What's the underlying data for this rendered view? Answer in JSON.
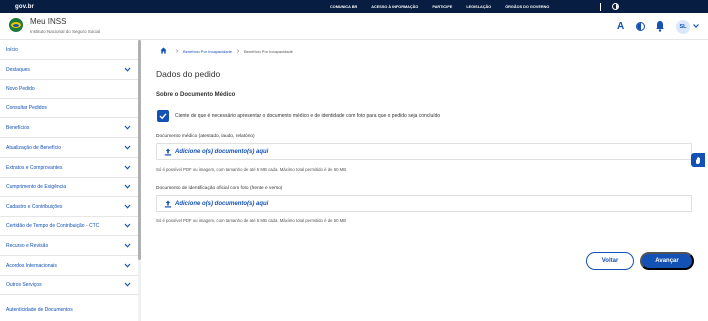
{
  "govbar": {
    "logo": "gov.br",
    "links": [
      "COMUNICA BR",
      "ACESSO À INFORMAÇÃO",
      "PARTICIPE",
      "LEGISLAÇÃO",
      "ÓRGÃOS DO GOVERNO"
    ]
  },
  "header": {
    "title": "Meu INSS",
    "subtitle": "Instituto Nacional do Seguro Social",
    "font_button": "A",
    "avatar_initials": "SL",
    "brand_color": "#1351b4"
  },
  "sidebar": {
    "items": [
      {
        "label": "Início",
        "has_chevron": false
      },
      {
        "label": "Destaques",
        "has_chevron": true
      },
      {
        "label": "Novo Pedido",
        "has_chevron": false
      },
      {
        "label": "Consultar Pedidos",
        "has_chevron": false
      },
      {
        "label": "Benefícios",
        "has_chevron": true
      },
      {
        "label": "Atualização de Benefício",
        "has_chevron": true
      },
      {
        "label": "Extratos e Comprovantes",
        "has_chevron": true
      },
      {
        "label": "Cumprimento de Exigência",
        "has_chevron": true
      },
      {
        "label": "Cadastro e Contribuições",
        "has_chevron": true
      },
      {
        "label": "Certidão de Tempo de Contribuição - CTC",
        "has_chevron": true
      },
      {
        "label": "Recurso e Revisão",
        "has_chevron": true
      },
      {
        "label": "Acordos Internacionais",
        "has_chevron": true
      },
      {
        "label": "Outros Serviços",
        "has_chevron": true
      },
      {
        "label": "Autenticidade de Documentos",
        "has_chevron": false
      }
    ]
  },
  "breadcrumb": [
    "Benefício Por Incapacidade",
    "Benefício Por Incapacidade"
  ],
  "main": {
    "heading": "Dados do pedido",
    "section_title": "Sobre o Documento Médico",
    "checkbox_checked": true,
    "checkbox_text": "Ciente de que é necessário apresentar o documento médico e de identidade com foto para que o pedido seja concluído",
    "fields": [
      {
        "label": "Documento médico (atestado, laudo, relatório)",
        "upload_text": "Adicione o(s) documento(s) aqui",
        "hint": "Só é possível PDF ou imagem, com tamanho de até 5 MB cada. Máximo total permitido é de 50 MB"
      },
      {
        "label": "Documento de identificação oficial com foto (frente e verso)",
        "upload_text": "Adicione o(s) documento(s) aqui",
        "hint": "Só é possível PDF ou imagem, com tamanho de até 5 MB cada. Máximo total permitido é de 50 MB"
      }
    ],
    "back_label": "Voltar",
    "next_label": "Avançar"
  }
}
